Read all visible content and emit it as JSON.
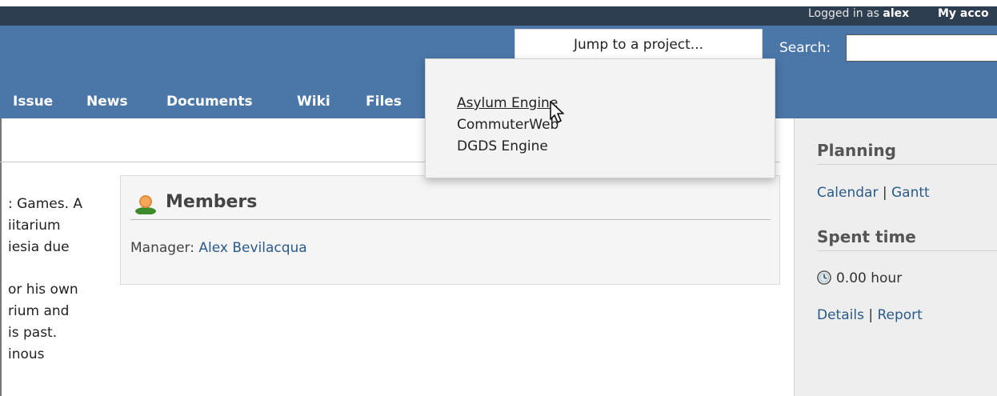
{
  "topbar": {
    "logged_prefix": "Logged in as ",
    "user": "alex",
    "my_account": "My acco"
  },
  "header": {
    "search_label": "Search:",
    "search_value": ""
  },
  "menu": [
    "Issue",
    "News",
    "Documents",
    "Wiki",
    "Files"
  ],
  "jump": {
    "label": "Jump to a project...",
    "projects": [
      "Asylum Engine",
      "CommuterWeb",
      "DGDS Engine"
    ],
    "hovered_index": 0
  },
  "description": {
    "lines_a": [
      ": Games. A",
      "iitarium",
      "iesia due"
    ],
    "lines_b": [
      "or his own",
      "rium and",
      "is past.",
      "inous"
    ]
  },
  "members": {
    "title": "Members",
    "manager_label": "Manager: ",
    "manager_name": "Alex Bevilacqua"
  },
  "sidebar": {
    "planning_heading": "Planning",
    "calendar": "Calendar",
    "gantt": "Gantt",
    "separator": " | ",
    "spent_heading": "Spent time",
    "spent_value": "0.00 hour",
    "details": "Details",
    "report": "Report"
  }
}
